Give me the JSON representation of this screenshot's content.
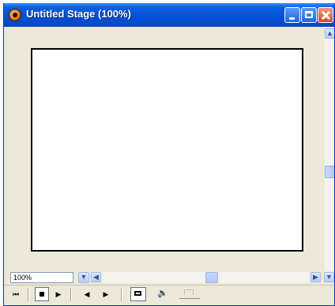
{
  "window": {
    "title": "Untitled Stage (100%)"
  },
  "status": {
    "zoom_value": "100%"
  },
  "icons": {
    "app": "director-app-icon",
    "minimize": "minimize-icon",
    "maximize": "maximize-icon",
    "close": "close-icon",
    "scroll_up": "▲",
    "scroll_down": "▼",
    "scroll_left": "◀",
    "scroll_right": "▶",
    "zoom_dropdown": "▼",
    "rewind": "⏮",
    "step_back": "◀",
    "play": "▶",
    "volume": "🔈"
  },
  "colors": {
    "titlebar": "#0450d6",
    "stage_border": "#000000",
    "window_bg": "#ece9d8"
  }
}
